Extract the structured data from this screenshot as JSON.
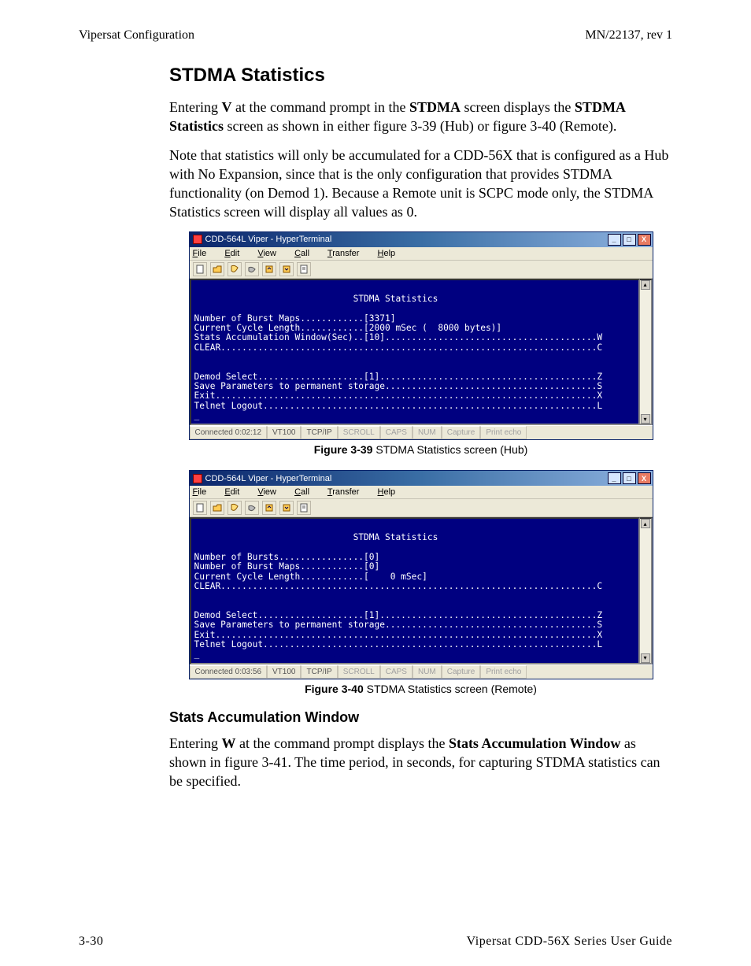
{
  "runhead": {
    "left": "Vipersat Configuration",
    "right": "MN/22137, rev 1"
  },
  "h1": "STDMA Statistics",
  "p1_a": "Entering ",
  "p1_b": "V",
  "p1_c": " at the command prompt in the ",
  "p1_d": "STDMA",
  "p1_e": " screen displays the ",
  "p1_f": "STDMA Statistics",
  "p1_g": " screen as shown in either figure 3-39 (Hub) or figure 3-40 (Remote).",
  "p2": "Note that statistics will only be accumulated for a CDD-56X that is configured as a Hub with No Expansion, since that is the only configuration that provides STDMA functionality (on Demod 1). Because a Remote unit is SCPC mode only, the STDMA Statistics screen will display all values as 0.",
  "menubar": {
    "file": "File",
    "edit": "Edit",
    "view": "View",
    "call": "Call",
    "transfer": "Transfer",
    "help": "Help"
  },
  "win": {
    "minimize": "_",
    "maximize": "□",
    "close": "X"
  },
  "status_labels": {
    "scroll": "SCROLL",
    "caps": "CAPS",
    "num": "NUM",
    "capture": "Capture",
    "printecho": "Print echo"
  },
  "hub": {
    "title": "CDD-564L Viper - HyperTerminal",
    "conn": "Connected 0:02:12",
    "emul": "VT100",
    "proto": "TCP/IP",
    "term": "\n                              STDMA Statistics\n\nNumber of Burst Maps............[3371]\nCurrent Cycle Length............[2000 mSec (  8000 bytes)]\nStats Accumulation Window(Sec)..[10]........................................W\nCLEAR.......................................................................C\n\n\nDemod Select....................[1].........................................Z\nSave Parameters to permanent storage........................................S\nExit........................................................................X\nTelnet Logout...............................................................L\n_"
  },
  "remote": {
    "title": "CDD-564L Viper - HyperTerminal",
    "conn": "Connected 0:03:56",
    "emul": "VT100",
    "proto": "TCP/IP",
    "term": "\n                              STDMA Statistics\n\nNumber of Bursts................[0]\nNumber of Burst Maps............[0]\nCurrent Cycle Length............[    0 mSec]\nCLEAR.......................................................................C\n\n\nDemod Select....................[1].........................................Z\nSave Parameters to permanent storage........................................S\nExit........................................................................X\nTelnet Logout...............................................................L\n_"
  },
  "fig1": {
    "num": "Figure 3-39",
    "cap": "   STDMA Statistics screen (Hub)"
  },
  "fig2": {
    "num": "Figure 3-40",
    "cap": "   STDMA Statistics screen (Remote)"
  },
  "h2": "Stats Accumulation Window",
  "p3_a": "Entering ",
  "p3_b": "W",
  "p3_c": " at the command prompt displays the ",
  "p3_d": "Stats Accumulation Window",
  "p3_e": " as shown in figure 3-41. The time period, in seconds, for capturing STDMA statistics can be specified.",
  "footer": {
    "left": "3-30",
    "right": "Vipersat CDD-56X Series User Guide"
  }
}
